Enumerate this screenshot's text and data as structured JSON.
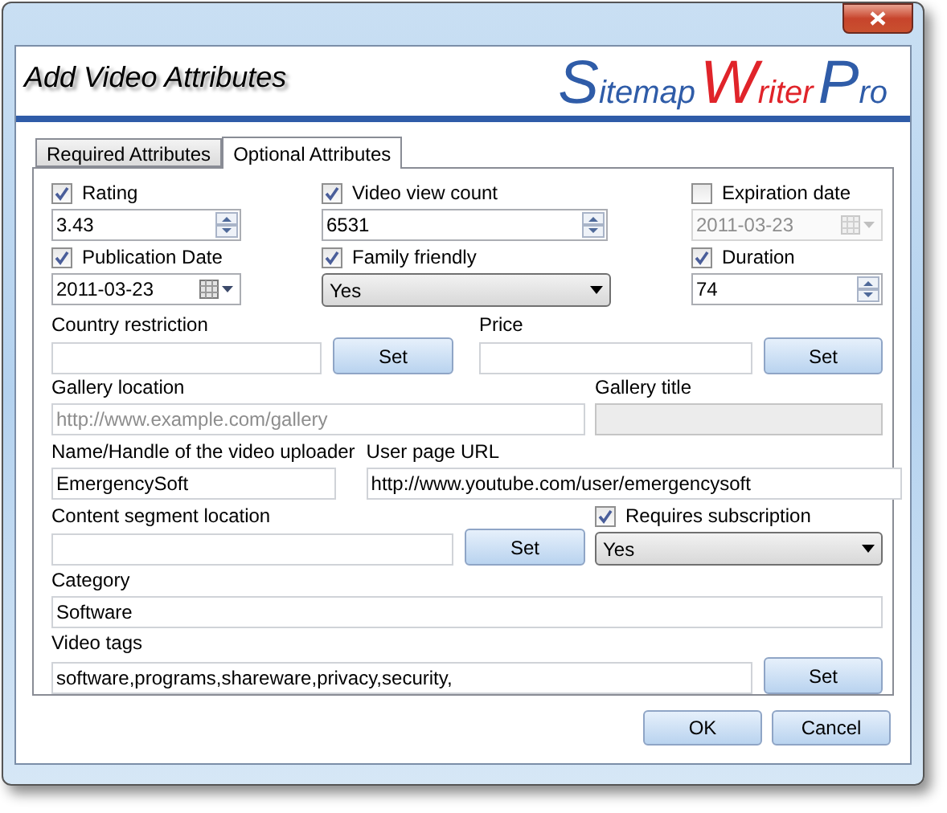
{
  "header": {
    "title": "Add Video Attributes",
    "logo": [
      {
        "text": "Sitemap",
        "color": "#2f5ca8"
      },
      {
        "text": "Writer",
        "color": "#e0242a"
      },
      {
        "text": "Pro",
        "color": "#2f5ca8"
      }
    ]
  },
  "tabs": [
    {
      "label": "Required Attributes",
      "selected": false
    },
    {
      "label": "Optional Attributes",
      "selected": true
    }
  ],
  "rating": {
    "label": "Rating",
    "checked": true,
    "value": "3.43"
  },
  "view_count": {
    "label": "Video view count",
    "checked": true,
    "value": "6531"
  },
  "expiration": {
    "label": "Expiration date",
    "checked": false,
    "value": "2011-03-23"
  },
  "publication": {
    "label": "Publication Date",
    "checked": true,
    "value": "2011-03-23"
  },
  "family_friendly": {
    "label": "Family friendly",
    "checked": true,
    "value": "Yes"
  },
  "duration": {
    "label": "Duration",
    "checked": true,
    "value": "74"
  },
  "country_restriction": {
    "label": "Country restriction",
    "button": "Set"
  },
  "price": {
    "label": "Price",
    "button": "Set"
  },
  "gallery_location": {
    "label": "Gallery location",
    "placeholder": "http://www.example.com/gallery"
  },
  "gallery_title": {
    "label": "Gallery title",
    "disabled": true
  },
  "uploader": {
    "label": "Name/Handle of the video uploader",
    "value": "EmergencySoft"
  },
  "user_page_url": {
    "label": "User page URL",
    "value": "http://www.youtube.com/user/emergencysoft"
  },
  "content_segment": {
    "label": "Content segment location",
    "button": "Set"
  },
  "requires_subscription": {
    "label": "Requires subscription",
    "checked": true,
    "value": "Yes"
  },
  "category": {
    "label": "Category",
    "value": "Software"
  },
  "video_tags": {
    "label": "Video tags",
    "value": "software,programs,shareware,privacy,security,",
    "button": "Set"
  },
  "buttons": [
    "OK",
    "Cancel"
  ]
}
